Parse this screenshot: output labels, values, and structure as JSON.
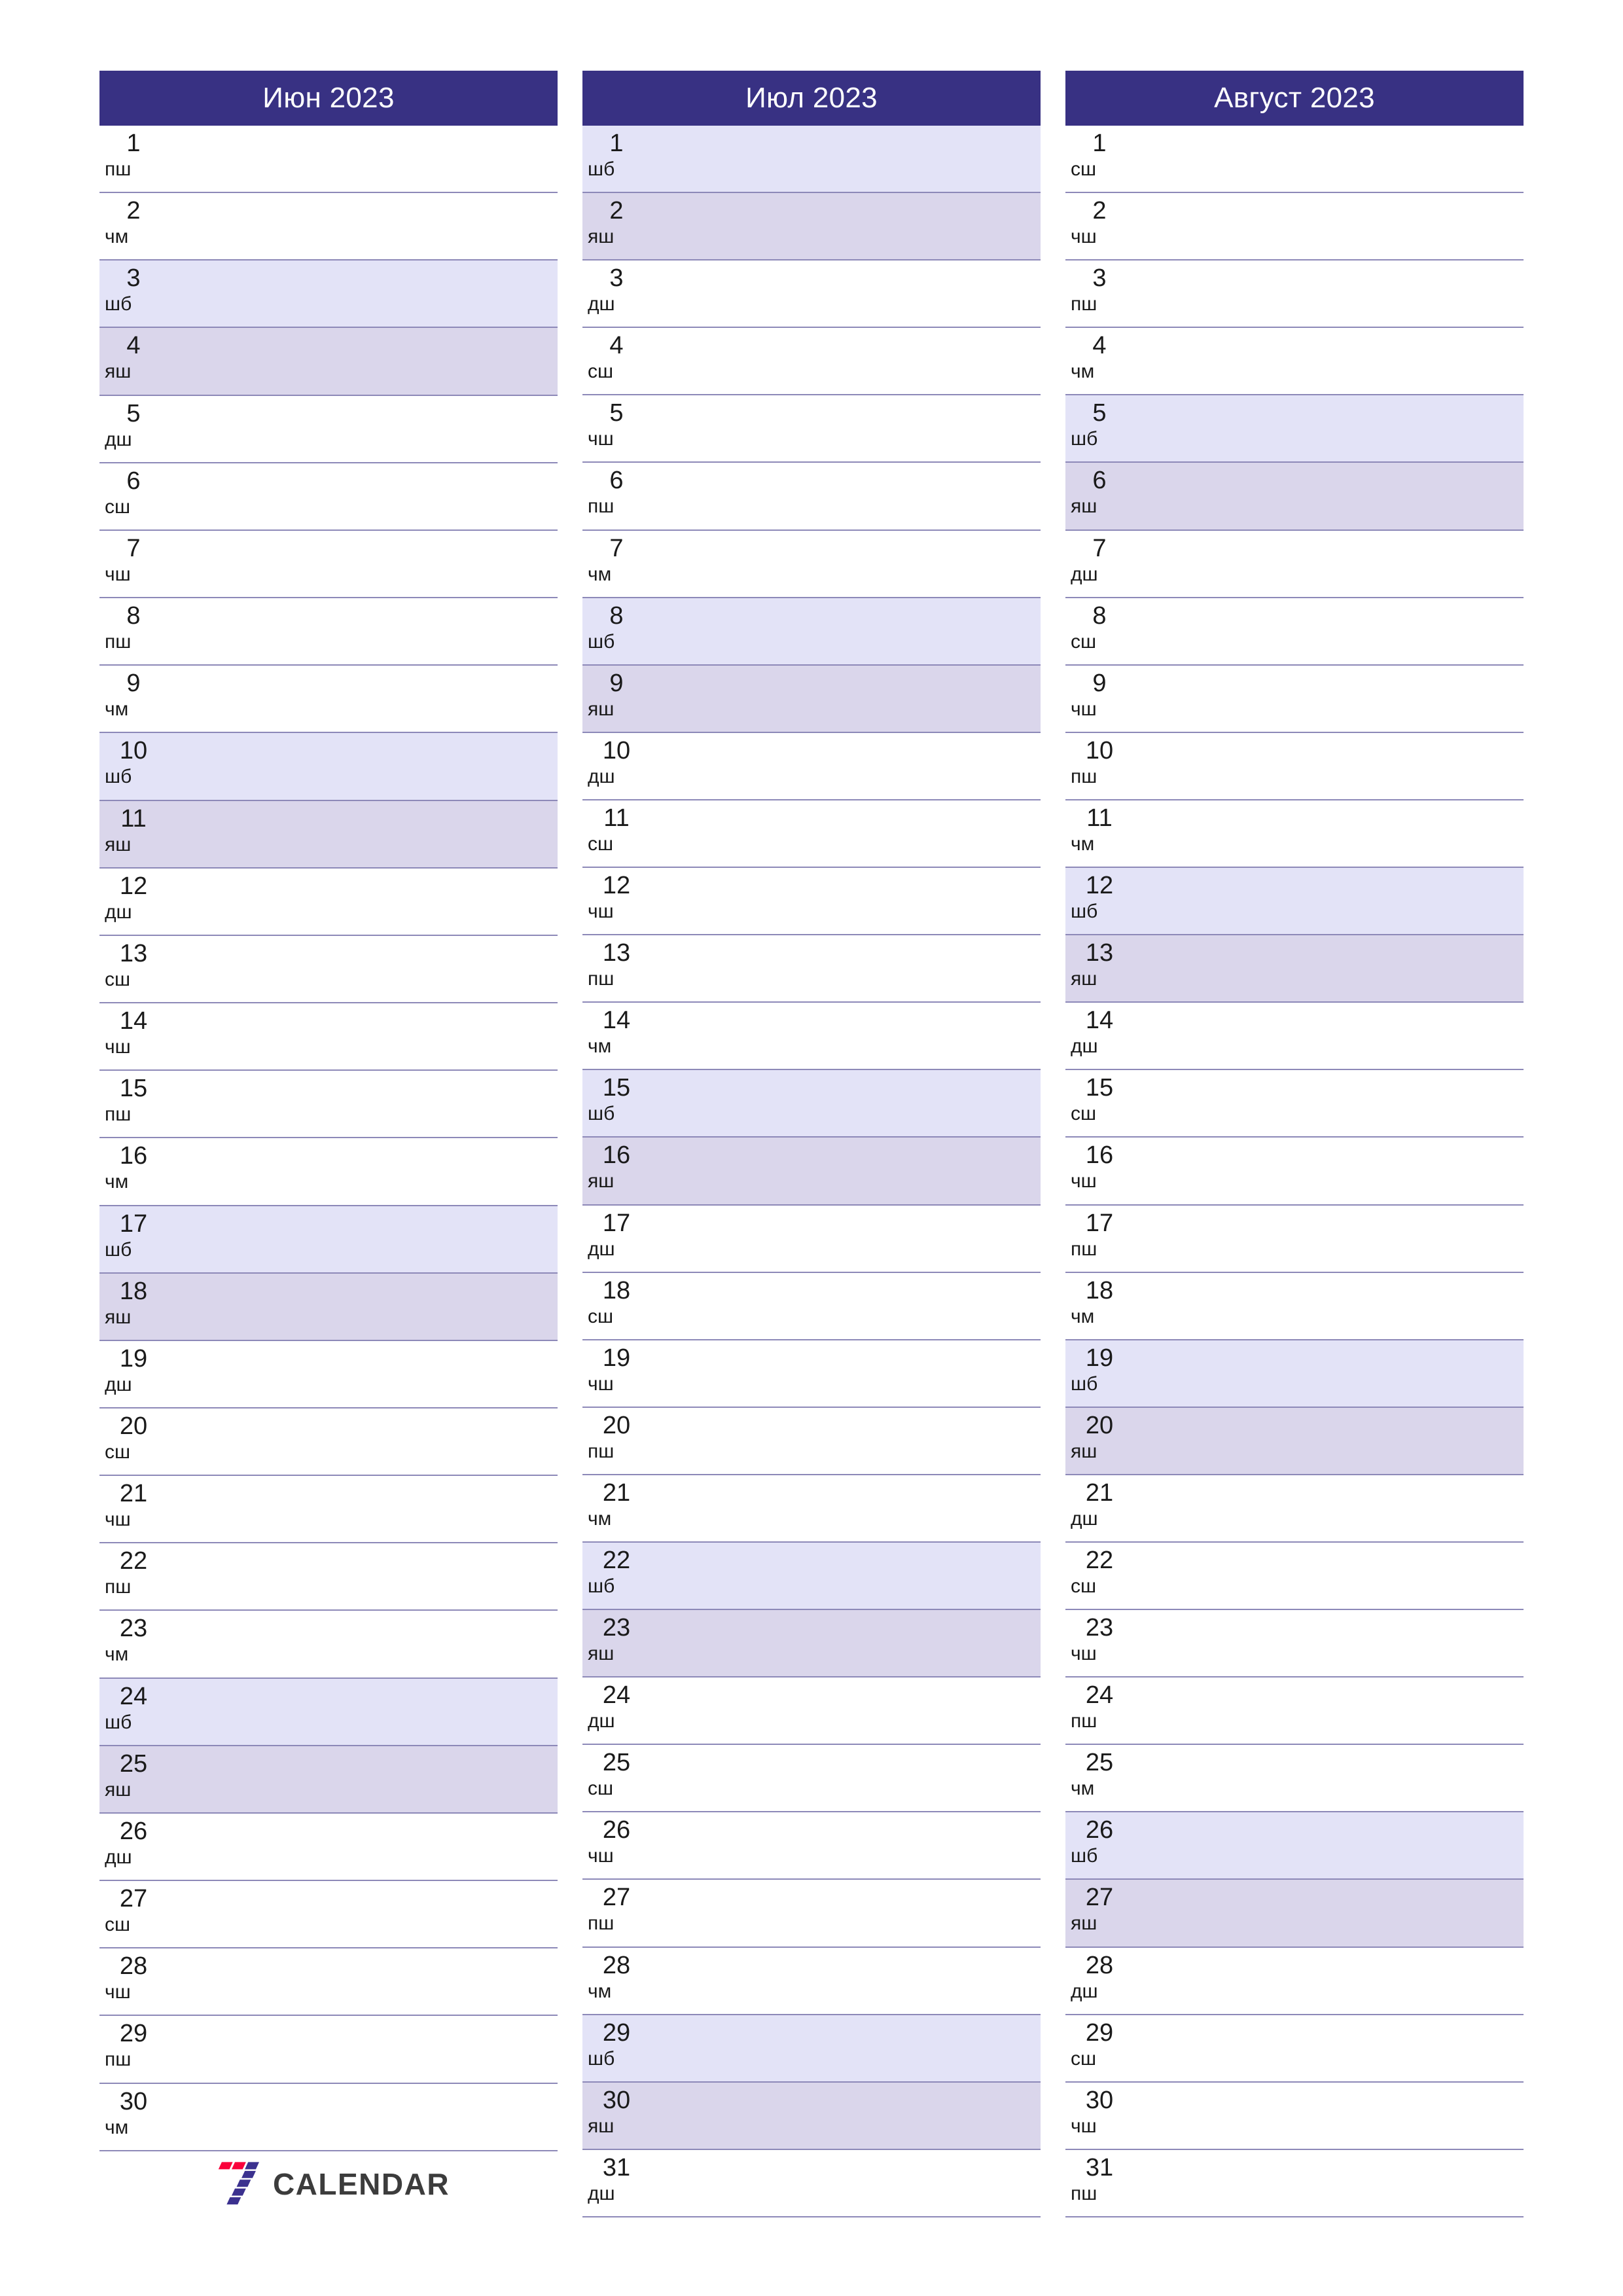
{
  "document": {
    "title": "Июн 2023 – Август 2023",
    "year": "2023",
    "orientation": "portrait"
  },
  "colors": {
    "header_bg": "#383183",
    "header_text": "#ffffff",
    "saturday_bg": "#e3e3f7",
    "sunday_bg": "#dad6eb",
    "divider": "#8d89b8",
    "logo_red": "#fa013b",
    "logo_blue": "#3b318f",
    "logo_text": "#3c3c3c"
  },
  "weekday_abbr": {
    "monday": "дш",
    "tuesday": "сш",
    "wednesday": "чш",
    "thursday": "пш",
    "friday": "чм",
    "saturday": "шб",
    "sunday": "яш"
  },
  "footer": {
    "logo_text": "CALENDAR",
    "logo_mark": "seven-blocks-icon"
  },
  "months": [
    {
      "title": "Июн 2023",
      "name": "Июн",
      "year": "2023",
      "days": [
        {
          "num": "1",
          "abbr": "пш",
          "type": "weekday"
        },
        {
          "num": "2",
          "abbr": "чм",
          "type": "weekday"
        },
        {
          "num": "3",
          "abbr": "шб",
          "type": "sat"
        },
        {
          "num": "4",
          "abbr": "яш",
          "type": "sun"
        },
        {
          "num": "5",
          "abbr": "дш",
          "type": "weekday"
        },
        {
          "num": "6",
          "abbr": "сш",
          "type": "weekday"
        },
        {
          "num": "7",
          "abbr": "чш",
          "type": "weekday"
        },
        {
          "num": "8",
          "abbr": "пш",
          "type": "weekday"
        },
        {
          "num": "9",
          "abbr": "чм",
          "type": "weekday"
        },
        {
          "num": "10",
          "abbr": "шб",
          "type": "sat"
        },
        {
          "num": "11",
          "abbr": "яш",
          "type": "sun"
        },
        {
          "num": "12",
          "abbr": "дш",
          "type": "weekday"
        },
        {
          "num": "13",
          "abbr": "сш",
          "type": "weekday"
        },
        {
          "num": "14",
          "abbr": "чш",
          "type": "weekday"
        },
        {
          "num": "15",
          "abbr": "пш",
          "type": "weekday"
        },
        {
          "num": "16",
          "abbr": "чм",
          "type": "weekday"
        },
        {
          "num": "17",
          "abbr": "шб",
          "type": "sat"
        },
        {
          "num": "18",
          "abbr": "яш",
          "type": "sun"
        },
        {
          "num": "19",
          "abbr": "дш",
          "type": "weekday"
        },
        {
          "num": "20",
          "abbr": "сш",
          "type": "weekday"
        },
        {
          "num": "21",
          "abbr": "чш",
          "type": "weekday"
        },
        {
          "num": "22",
          "abbr": "пш",
          "type": "weekday"
        },
        {
          "num": "23",
          "abbr": "чм",
          "type": "weekday"
        },
        {
          "num": "24",
          "abbr": "шб",
          "type": "sat"
        },
        {
          "num": "25",
          "abbr": "яш",
          "type": "sun"
        },
        {
          "num": "26",
          "abbr": "дш",
          "type": "weekday"
        },
        {
          "num": "27",
          "abbr": "сш",
          "type": "weekday"
        },
        {
          "num": "28",
          "abbr": "чш",
          "type": "weekday"
        },
        {
          "num": "29",
          "abbr": "пш",
          "type": "weekday"
        },
        {
          "num": "30",
          "abbr": "чм",
          "type": "weekday"
        }
      ],
      "has_logo_slot": true
    },
    {
      "title": "Июл 2023",
      "name": "Июл",
      "year": "2023",
      "days": [
        {
          "num": "1",
          "abbr": "шб",
          "type": "sat"
        },
        {
          "num": "2",
          "abbr": "яш",
          "type": "sun"
        },
        {
          "num": "3",
          "abbr": "дш",
          "type": "weekday"
        },
        {
          "num": "4",
          "abbr": "сш",
          "type": "weekday"
        },
        {
          "num": "5",
          "abbr": "чш",
          "type": "weekday"
        },
        {
          "num": "6",
          "abbr": "пш",
          "type": "weekday"
        },
        {
          "num": "7",
          "abbr": "чм",
          "type": "weekday"
        },
        {
          "num": "8",
          "abbr": "шб",
          "type": "sat"
        },
        {
          "num": "9",
          "abbr": "яш",
          "type": "sun"
        },
        {
          "num": "10",
          "abbr": "дш",
          "type": "weekday"
        },
        {
          "num": "11",
          "abbr": "сш",
          "type": "weekday"
        },
        {
          "num": "12",
          "abbr": "чш",
          "type": "weekday"
        },
        {
          "num": "13",
          "abbr": "пш",
          "type": "weekday"
        },
        {
          "num": "14",
          "abbr": "чм",
          "type": "weekday"
        },
        {
          "num": "15",
          "abbr": "шб",
          "type": "sat"
        },
        {
          "num": "16",
          "abbr": "яш",
          "type": "sun"
        },
        {
          "num": "17",
          "abbr": "дш",
          "type": "weekday"
        },
        {
          "num": "18",
          "abbr": "сш",
          "type": "weekday"
        },
        {
          "num": "19",
          "abbr": "чш",
          "type": "weekday"
        },
        {
          "num": "20",
          "abbr": "пш",
          "type": "weekday"
        },
        {
          "num": "21",
          "abbr": "чм",
          "type": "weekday"
        },
        {
          "num": "22",
          "abbr": "шб",
          "type": "sat"
        },
        {
          "num": "23",
          "abbr": "яш",
          "type": "sun"
        },
        {
          "num": "24",
          "abbr": "дш",
          "type": "weekday"
        },
        {
          "num": "25",
          "abbr": "сш",
          "type": "weekday"
        },
        {
          "num": "26",
          "abbr": "чш",
          "type": "weekday"
        },
        {
          "num": "27",
          "abbr": "пш",
          "type": "weekday"
        },
        {
          "num": "28",
          "abbr": "чм",
          "type": "weekday"
        },
        {
          "num": "29",
          "abbr": "шб",
          "type": "sat"
        },
        {
          "num": "30",
          "abbr": "яш",
          "type": "sun"
        },
        {
          "num": "31",
          "abbr": "дш",
          "type": "weekday"
        }
      ],
      "has_logo_slot": false
    },
    {
      "title": "Август 2023",
      "name": "Август",
      "year": "2023",
      "days": [
        {
          "num": "1",
          "abbr": "сш",
          "type": "weekday"
        },
        {
          "num": "2",
          "abbr": "чш",
          "type": "weekday"
        },
        {
          "num": "3",
          "abbr": "пш",
          "type": "weekday"
        },
        {
          "num": "4",
          "abbr": "чм",
          "type": "weekday"
        },
        {
          "num": "5",
          "abbr": "шб",
          "type": "sat"
        },
        {
          "num": "6",
          "abbr": "яш",
          "type": "sun"
        },
        {
          "num": "7",
          "abbr": "дш",
          "type": "weekday"
        },
        {
          "num": "8",
          "abbr": "сш",
          "type": "weekday"
        },
        {
          "num": "9",
          "abbr": "чш",
          "type": "weekday"
        },
        {
          "num": "10",
          "abbr": "пш",
          "type": "weekday"
        },
        {
          "num": "11",
          "abbr": "чм",
          "type": "weekday"
        },
        {
          "num": "12",
          "abbr": "шб",
          "type": "sat"
        },
        {
          "num": "13",
          "abbr": "яш",
          "type": "sun"
        },
        {
          "num": "14",
          "abbr": "дш",
          "type": "weekday"
        },
        {
          "num": "15",
          "abbr": "сш",
          "type": "weekday"
        },
        {
          "num": "16",
          "abbr": "чш",
          "type": "weekday"
        },
        {
          "num": "17",
          "abbr": "пш",
          "type": "weekday"
        },
        {
          "num": "18",
          "abbr": "чм",
          "type": "weekday"
        },
        {
          "num": "19",
          "abbr": "шб",
          "type": "sat"
        },
        {
          "num": "20",
          "abbr": "яш",
          "type": "sun"
        },
        {
          "num": "21",
          "abbr": "дш",
          "type": "weekday"
        },
        {
          "num": "22",
          "abbr": "сш",
          "type": "weekday"
        },
        {
          "num": "23",
          "abbr": "чш",
          "type": "weekday"
        },
        {
          "num": "24",
          "abbr": "пш",
          "type": "weekday"
        },
        {
          "num": "25",
          "abbr": "чм",
          "type": "weekday"
        },
        {
          "num": "26",
          "abbr": "шб",
          "type": "sat"
        },
        {
          "num": "27",
          "abbr": "яш",
          "type": "sun"
        },
        {
          "num": "28",
          "abbr": "дш",
          "type": "weekday"
        },
        {
          "num": "29",
          "abbr": "сш",
          "type": "weekday"
        },
        {
          "num": "30",
          "abbr": "чш",
          "type": "weekday"
        },
        {
          "num": "31",
          "abbr": "пш",
          "type": "weekday"
        }
      ],
      "has_logo_slot": false
    }
  ]
}
